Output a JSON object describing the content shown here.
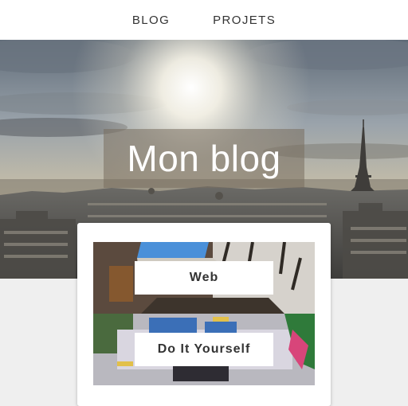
{
  "nav": {
    "items": [
      "BLOG",
      "PROJETS"
    ]
  },
  "hero": {
    "title": "Mon blog"
  },
  "categories": [
    {
      "label": "Web"
    },
    {
      "label": "Do It Yourself"
    }
  ],
  "colors": {
    "nav_text": "#333333",
    "page_bg": "#efefef"
  }
}
